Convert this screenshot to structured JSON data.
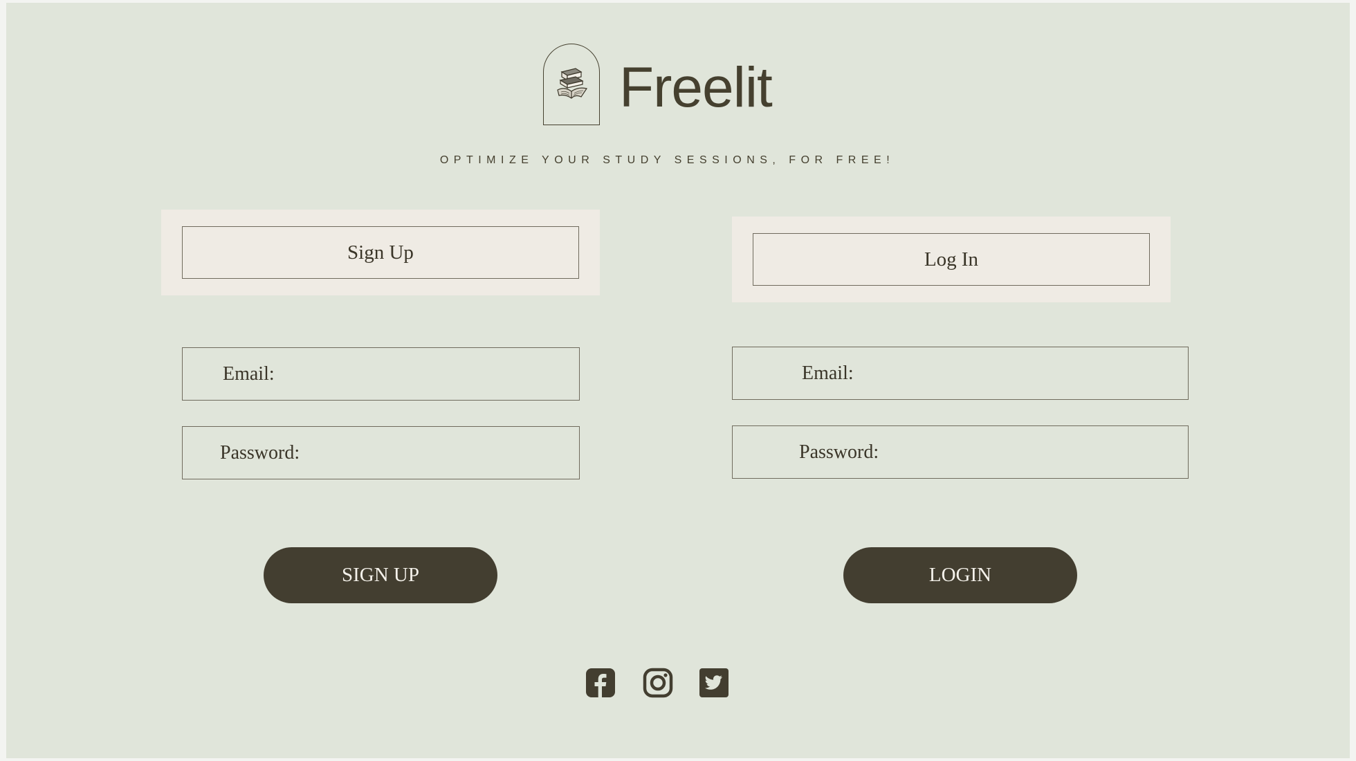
{
  "brand": {
    "name": "Freelit",
    "logo_icon": "books-icon",
    "tagline": "OPTIMIZE YOUR STUDY SESSIONS, FOR FREE!"
  },
  "signup": {
    "tab_label": "Sign Up",
    "email_label": "Email:",
    "password_label": "Password:",
    "submit_label": "SIGN UP"
  },
  "login": {
    "tab_label": "Log In",
    "email_label": "Email:",
    "password_label": "Password:",
    "submit_label": "LOGIN"
  },
  "social": [
    {
      "name": "facebook",
      "icon": "facebook-icon"
    },
    {
      "name": "instagram",
      "icon": "instagram-icon"
    },
    {
      "name": "twitter",
      "icon": "twitter-icon"
    }
  ],
  "colors": {
    "background": "#e0e5da",
    "panel": "#efebe4",
    "text_dark": "#45402f",
    "button": "#433e30",
    "button_text": "#f4f1ea"
  }
}
